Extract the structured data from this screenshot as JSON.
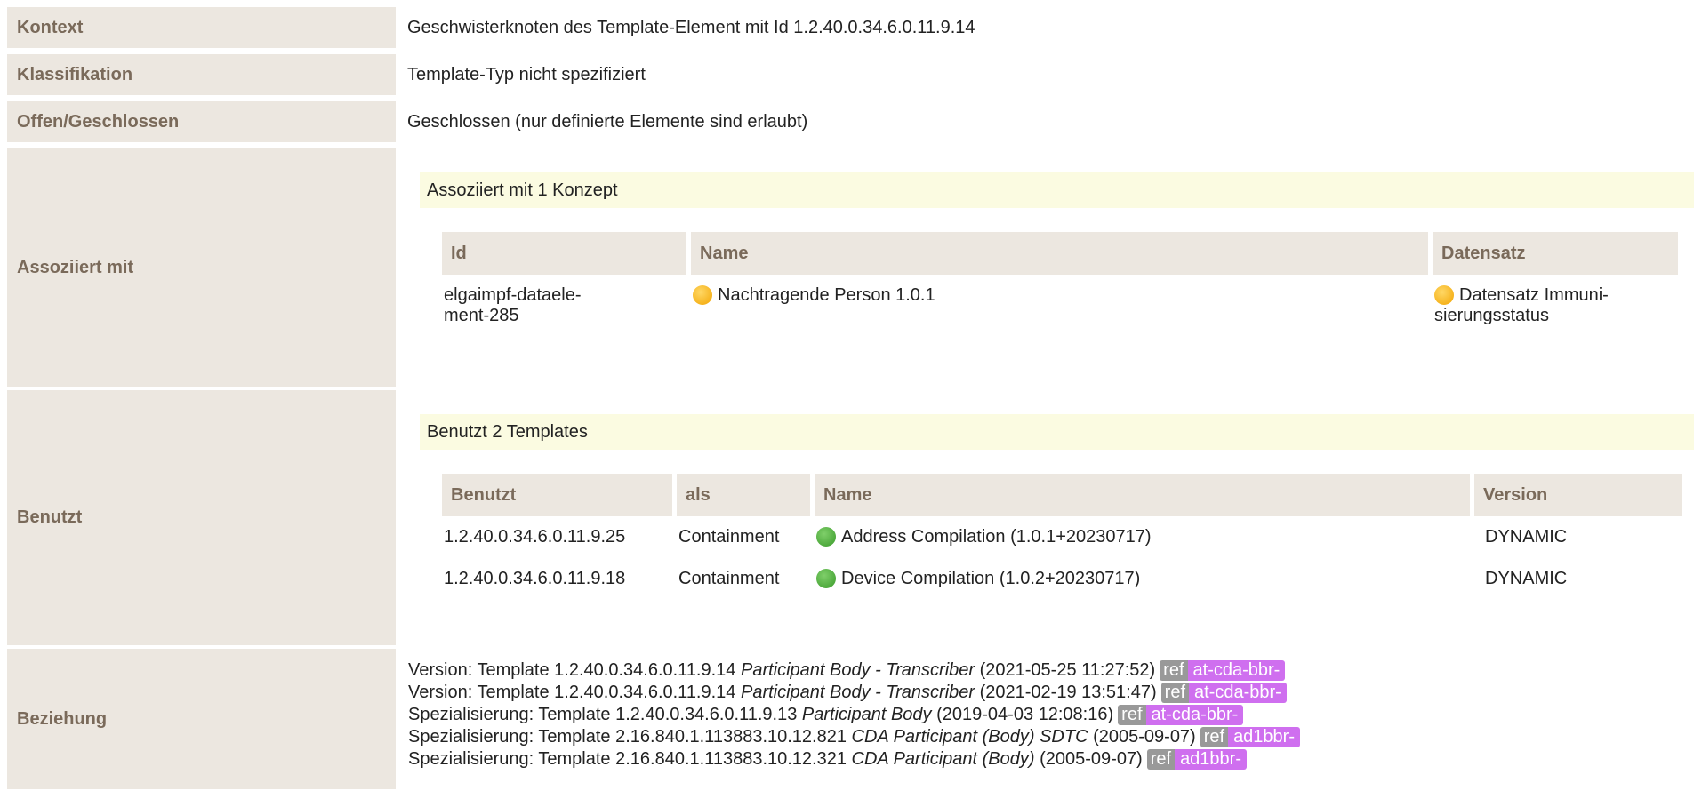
{
  "kontext": {
    "label": "Kontext",
    "value": "Geschwisterknoten des Template-Element mit Id 1.2.40.0.34.6.0.11.9.14"
  },
  "klassifikation": {
    "label": "Klassifikation",
    "value": "Template-Typ nicht spezifiziert"
  },
  "offen": {
    "label": "Offen/Geschlossen",
    "value": "Geschlossen (nur definierte Elemente sind erlaubt)"
  },
  "assoziiert": {
    "label": "Assoziiert mit",
    "header": "Assoziiert mit 1 Konzept",
    "columns": [
      "Id",
      "Name",
      "Datensatz"
    ],
    "rows": [
      {
        "id_line1": "elgaimpf-dataele-",
        "id_line2": "ment-285",
        "name": "Nachtragende Person 1.0.1",
        "datensatz_line1": "Datensatz Immuni-",
        "datensatz_line2": "sierungsstatus",
        "status_icon": "yellow-circle-icon"
      }
    ]
  },
  "benutzt": {
    "label": "Benutzt",
    "header": "Benutzt 2 Templates",
    "columns": [
      "Benutzt",
      "als",
      "Name",
      "Version"
    ],
    "rows": [
      {
        "id": "1.2.40.0.34.6.0.11.9.25",
        "als": "Containment",
        "name": "Address Compilation (1.0.1+20230717)",
        "version": "DYNAMIC",
        "status_icon": "green-circle-icon"
      },
      {
        "id": "1.2.40.0.34.6.0.11.9.18",
        "als": "Containment",
        "name": "Device Compilation (1.0.2+20230717)",
        "version": "DYNAMIC",
        "status_icon": "green-circle-icon"
      }
    ]
  },
  "beziehung": {
    "label": "Beziehung",
    "items": [
      {
        "prefix": "Version: Template 1.2.40.0.34.6.0.11.9.14",
        "title": "Participant Body - Transcriber",
        "date": "(2021‑05‑25 11:27:52)",
        "ref": "ref",
        "tag": "at-cda-bbr-"
      },
      {
        "prefix": "Version: Template 1.2.40.0.34.6.0.11.9.14",
        "title": "Participant Body - Transcriber",
        "date": "(2021‑02‑19 13:51:47)",
        "ref": "ref",
        "tag": "at-cda-bbr-"
      },
      {
        "prefix": "Spezialisierung: Template 1.2.40.0.34.6.0.11.9.13",
        "title": "Participant Body",
        "date": "(2019‑04‑03 12:08:16)",
        "ref": "ref",
        "tag": "at-cda-bbr-"
      },
      {
        "prefix": "Spezialisierung: Template 2.16.840.1.113883.10.12.821",
        "title": "CDA Participant (Body) SDTC",
        "date": "(2005‑09‑07)",
        "ref": "ref",
        "tag": "ad1bbr-"
      },
      {
        "prefix": "Spezialisierung: Template 2.16.840.1.113883.10.12.321",
        "title": "CDA Participant (Body)",
        "date": "(2005‑09‑07)",
        "ref": "ref",
        "tag": "ad1bbr-"
      }
    ]
  },
  "colors": {
    "label_bg": "#ece7e0",
    "label_text": "#7a6a5a",
    "header_bg": "#fbfbe1",
    "ref_bg": "#999999",
    "tag_bg": "#cf6fef"
  }
}
